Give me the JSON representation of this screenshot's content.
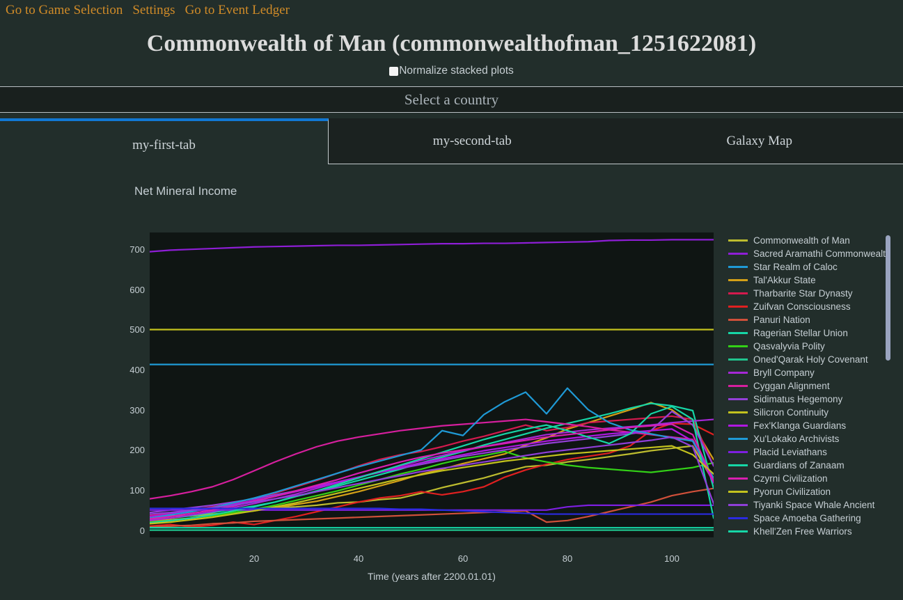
{
  "topnav": {
    "links": [
      {
        "label": "Go to Game Selection",
        "name": "nav-game-selection"
      },
      {
        "label": "Settings",
        "name": "nav-settings"
      },
      {
        "label": "Go to Event Ledger",
        "name": "nav-event-ledger"
      }
    ]
  },
  "header": {
    "title": "Commonwealth of Man (commonwealthofman_1251622081)",
    "normalize_label": "Normalize stacked plots",
    "normalize_checked": false,
    "country_select_value": "Select a country"
  },
  "tabs": [
    {
      "label": "my-first-tab",
      "active": true
    },
    {
      "label": "my-second-tab",
      "active": false
    },
    {
      "label": "Galaxy Map",
      "active": false
    }
  ],
  "colors": {
    "page_background": "#222e2b",
    "plot_background": "#0f1513",
    "nav_link": "#d08b28",
    "text": "#c6cfd4",
    "active_tab_accent": "#1178d4",
    "scrollbar_thumb": "#9aa4c0"
  },
  "chart_data": {
    "type": "line",
    "title": "Net Mineral Income",
    "xlabel": "Time (years after 2200.01.01)",
    "ylabel": "",
    "xlim": [
      0,
      108
    ],
    "ylim": [
      -18,
      742
    ],
    "xticks": [
      20,
      40,
      60,
      80,
      100
    ],
    "yticks": [
      0,
      100,
      200,
      300,
      400,
      500,
      600,
      700
    ],
    "grid": false,
    "legend_position": "right",
    "x": [
      0,
      4,
      8,
      12,
      16,
      20,
      24,
      28,
      32,
      36,
      40,
      44,
      48,
      52,
      56,
      60,
      64,
      68,
      72,
      76,
      80,
      84,
      88,
      92,
      96,
      100,
      104,
      108
    ],
    "series": [
      {
        "name": "Commonwealth of Man",
        "color": "#bdbc2f",
        "values": [
          30,
          36,
          35,
          40,
          44,
          50,
          56,
          58,
          62,
          68,
          70,
          76,
          80,
          92,
          106,
          118,
          130,
          145,
          158,
          162,
          170,
          176,
          183,
          190,
          198,
          204,
          210,
          120
        ]
      },
      {
        "name": "Sacred Aramathi Commonwealth",
        "color": "#8e1ed6",
        "values": [
          694,
          698,
          700,
          702,
          704,
          706,
          707,
          708,
          709,
          710,
          710,
          711,
          712,
          713,
          714,
          714,
          715,
          715,
          716,
          717,
          718,
          719,
          722,
          723,
          723,
          724,
          724,
          724
        ]
      },
      {
        "name": "Star Realm of Caloc",
        "color": "#1f9ad6",
        "values": [
          413,
          413,
          413,
          413,
          413,
          413,
          413,
          413,
          413,
          413,
          413,
          413,
          413,
          413,
          413,
          413,
          413,
          413,
          413,
          413,
          413,
          413,
          413,
          413,
          413,
          413,
          413,
          413
        ]
      },
      {
        "name": "Tal'Akkur State",
        "color": "#d4a017",
        "values": [
          22,
          26,
          30,
          36,
          42,
          48,
          56,
          64,
          72,
          84,
          96,
          110,
          124,
          140,
          152,
          166,
          178,
          190,
          212,
          230,
          252,
          268,
          284,
          300,
          318,
          300,
          262,
          176
        ]
      },
      {
        "name": "Tharbarite Star Dynasty",
        "color": "#d41a4e",
        "values": [
          36,
          42,
          50,
          58,
          66,
          80,
          92,
          108,
          124,
          142,
          160,
          176,
          188,
          196,
          208,
          222,
          234,
          248,
          262,
          248,
          256,
          268,
          272,
          276,
          280,
          284,
          276,
          160
        ]
      },
      {
        "name": "Zuifvan Consciousness",
        "color": "#e02020",
        "values": [
          10,
          14,
          8,
          12,
          20,
          14,
          24,
          34,
          46,
          58,
          70,
          80,
          86,
          96,
          88,
          96,
          108,
          132,
          150,
          164,
          176,
          184,
          192,
          210,
          248,
          266,
          264,
          238
        ]
      },
      {
        "name": "Panuri Nation",
        "color": "#d0503a",
        "values": [
          8,
          10,
          12,
          16,
          18,
          22,
          24,
          26,
          28,
          30,
          32,
          34,
          36,
          38,
          40,
          42,
          44,
          46,
          48,
          20,
          24,
          34,
          46,
          58,
          70,
          86,
          96,
          104
        ]
      },
      {
        "name": "Ragerian Stellar Union",
        "color": "#16d6a6",
        "values": [
          26,
          30,
          36,
          44,
          52,
          60,
          70,
          84,
          96,
          110,
          124,
          138,
          152,
          168,
          182,
          196,
          212,
          226,
          240,
          254,
          266,
          278,
          290,
          304,
          316,
          310,
          298,
          104
        ]
      },
      {
        "name": "Qasvalyvia Polity",
        "color": "#33d117",
        "values": [
          20,
          24,
          30,
          36,
          44,
          52,
          62,
          74,
          86,
          98,
          112,
          126,
          140,
          152,
          166,
          178,
          186,
          196,
          180,
          170,
          162,
          156,
          152,
          148,
          144,
          150,
          156,
          168
        ]
      },
      {
        "name": "Oned'Qarak Holy Covenant",
        "color": "#21c48e",
        "values": [
          0,
          0,
          0,
          0,
          0,
          0,
          0,
          0,
          0,
          0,
          0,
          0,
          0,
          0,
          0,
          0,
          0,
          0,
          0,
          0,
          0,
          0,
          0,
          0,
          0,
          0,
          0,
          0
        ]
      },
      {
        "name": "Bryll Company",
        "color": "#a628d6",
        "values": [
          24,
          30,
          38,
          46,
          56,
          66,
          78,
          90,
          104,
          118,
          132,
          146,
          160,
          174,
          186,
          198,
          208,
          218,
          228,
          238,
          244,
          250,
          254,
          258,
          262,
          268,
          272,
          276
        ]
      },
      {
        "name": "Cyggan Alignment",
        "color": "#d61f9e",
        "values": [
          78,
          86,
          96,
          108,
          126,
          148,
          170,
          190,
          208,
          222,
          232,
          240,
          248,
          254,
          260,
          264,
          268,
          272,
          276,
          270,
          264,
          258,
          250,
          244,
          238,
          232,
          226,
          120
        ]
      },
      {
        "name": "Sidimatus Hegemony",
        "color": "#9440d8",
        "values": [
          44,
          50,
          56,
          62,
          70,
          78,
          88,
          98,
          110,
          120,
          132,
          144,
          154,
          164,
          174,
          184,
          192,
          200,
          208,
          216,
          222,
          228,
          234,
          240,
          248,
          296,
          262,
          160
        ]
      },
      {
        "name": "Silicron Continuity",
        "color": "#c3c21e",
        "values": [
          500,
          500,
          500,
          500,
          500,
          500,
          500,
          500,
          500,
          500,
          500,
          500,
          500,
          500,
          500,
          500,
          500,
          500,
          500,
          500,
          500,
          500,
          500,
          500,
          500,
          500,
          500,
          500
        ]
      },
      {
        "name": "Fex'Klanga Guardians",
        "color": "#b018e0",
        "values": [
          34,
          40,
          48,
          56,
          64,
          74,
          84,
          96,
          108,
          120,
          132,
          144,
          156,
          168,
          178,
          188,
          198,
          206,
          214,
          222,
          228,
          234,
          240,
          244,
          248,
          252,
          222,
          118
        ]
      },
      {
        "name": "Xu'Lokako Archivists",
        "color": "#1f9ad6",
        "values": [
          30,
          38,
          46,
          56,
          68,
          80,
          94,
          110,
          126,
          142,
          158,
          172,
          186,
          200,
          248,
          236,
          288,
          320,
          344,
          290,
          354,
          300,
          268,
          250,
          240,
          230,
          222,
          130
        ]
      },
      {
        "name": "Placid Leviathans",
        "color": "#7d1fe0",
        "values": [
          50,
          50,
          50,
          50,
          50,
          50,
          50,
          50,
          50,
          50,
          50,
          50,
          50,
          50,
          50,
          50,
          50,
          50,
          50,
          50,
          58,
          62,
          62,
          62,
          62,
          62,
          62,
          62
        ]
      },
      {
        "name": "Guardians of Zanaam",
        "color": "#16d6a6",
        "values": [
          18,
          24,
          30,
          38,
          48,
          58,
          70,
          84,
          98,
          114,
          130,
          146,
          162,
          178,
          194,
          210,
          226,
          240,
          252,
          262,
          248,
          232,
          216,
          240,
          290,
          308,
          276,
          30
        ]
      },
      {
        "name": "Czyrni Civilization",
        "color": "#d81fb0",
        "values": [
          28,
          34,
          42,
          50,
          60,
          72,
          84,
          98,
          112,
          126,
          142,
          156,
          170,
          182,
          192,
          200,
          208,
          216,
          224,
          232,
          238,
          244,
          250,
          256,
          260,
          264,
          238,
          122
        ]
      },
      {
        "name": "Pyorun Civilization",
        "color": "#c3c21e",
        "values": [
          16,
          20,
          26,
          32,
          40,
          48,
          58,
          68,
          80,
          92,
          104,
          116,
          128,
          138,
          148,
          156,
          164,
          172,
          178,
          184,
          190,
          194,
          198,
          202,
          206,
          210,
          188,
          140
        ]
      },
      {
        "name": "Tiyanki Space Whale Ancient",
        "color": "#8f3fd8",
        "values": [
          40,
          44,
          50,
          56,
          62,
          70,
          78,
          86,
          96,
          106,
          116,
          126,
          136,
          146,
          154,
          162,
          170,
          178,
          186,
          194,
          200,
          206,
          212,
          218,
          224,
          232,
          208,
          66
        ]
      },
      {
        "name": "Space Amoeba Gathering",
        "color": "#2a2ae0",
        "values": [
          54,
          54,
          54,
          54,
          54,
          54,
          54,
          54,
          54,
          54,
          54,
          54,
          52,
          52,
          50,
          48,
          46,
          44,
          42,
          40,
          40,
          40,
          40,
          40,
          40,
          40,
          40,
          40
        ]
      },
      {
        "name": "Khell'Zen Free Warriors",
        "color": "#16d6a6",
        "values": [
          6,
          6,
          6,
          6,
          6,
          6,
          6,
          6,
          6,
          6,
          6,
          6,
          6,
          6,
          6,
          6,
          6,
          6,
          6,
          6,
          6,
          6,
          6,
          6,
          6,
          6,
          6,
          6
        ]
      }
    ]
  }
}
